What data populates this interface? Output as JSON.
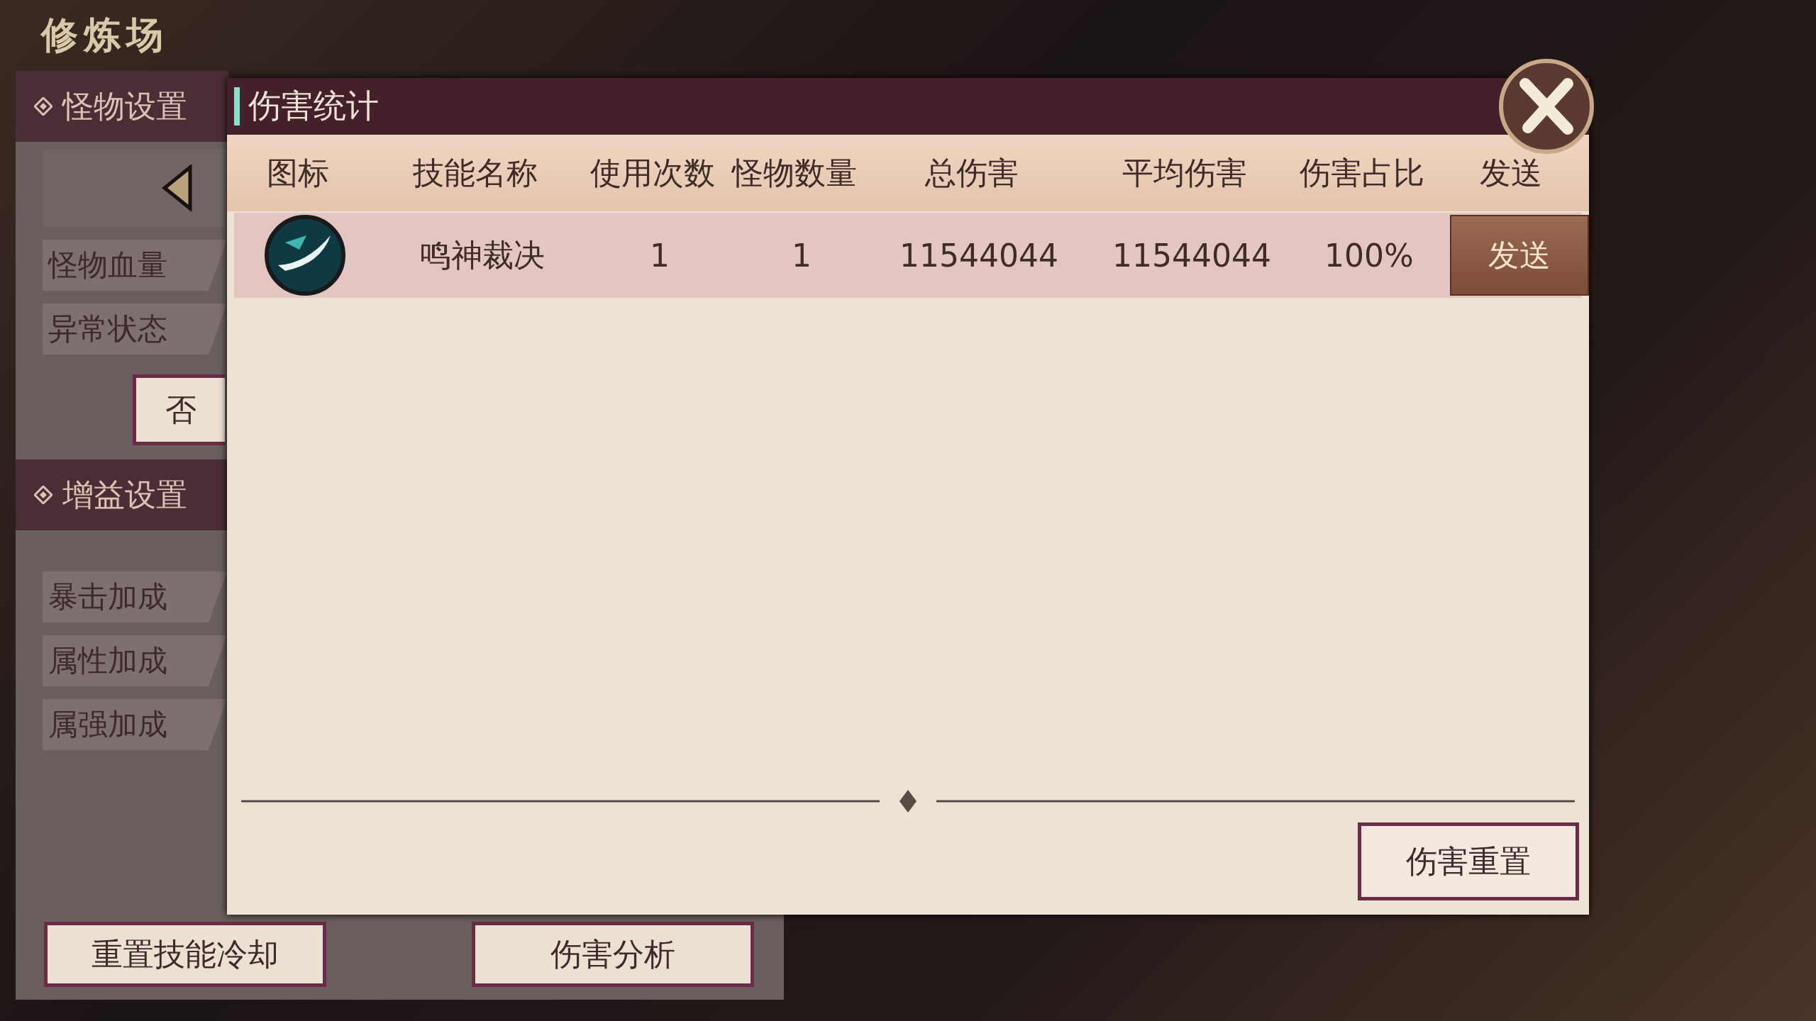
{
  "scene_title": "修炼场",
  "settings_panel": {
    "monster_section": {
      "title": "怪物设置",
      "labels": [
        "怪物血量",
        "异常状态"
      ],
      "toggle_button": "否"
    },
    "buff_section": {
      "title": "增益设置",
      "labels": [
        "暴击加成",
        "属性加成",
        "属强加成"
      ]
    },
    "buttons": [
      "重置技能冷却",
      "伤害分析"
    ]
  },
  "dialog": {
    "title": "伤害统计",
    "columns": [
      "图标",
      "技能名称",
      "使用次数",
      "怪物数量",
      "总伤害",
      "平均伤害",
      "伤害占比",
      "发送"
    ],
    "rows": [
      {
        "skill": "鸣神裁决",
        "uses": "1",
        "monsters": "1",
        "total": "11544044",
        "average": "11544044",
        "share": "100%",
        "send_button": "发送"
      }
    ],
    "reset_button": "伤害重置"
  }
}
